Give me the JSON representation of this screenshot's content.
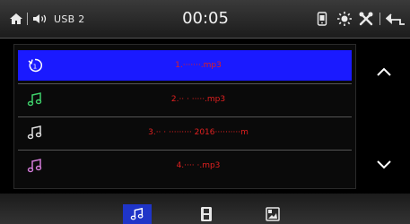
{
  "status_bar": {
    "home_icon": "home-icon",
    "audio_source_icon": "speaker-icon",
    "source_label": "USB 2",
    "clock": "00:05",
    "right_icons": [
      "phone-icon",
      "brightness-icon",
      "tools-icon",
      "back-icon"
    ]
  },
  "track_list": {
    "items": [
      {
        "title": "1.·······.mp3",
        "icon": "repeat-icon",
        "selected": true
      },
      {
        "title": "2.·· · ·····.mp3",
        "icon": "music-note-icon",
        "selected": false
      },
      {
        "title": "3.·· · ········· 2016··········m",
        "icon": "music-note-icon",
        "selected": false
      },
      {
        "title": "4.···· ·.mp3",
        "icon": "music-note-icon",
        "selected": false
      }
    ]
  },
  "scroll": {
    "up_icon": "chevron-up-icon",
    "down_icon": "chevron-down-icon"
  },
  "bottom_tabs": [
    {
      "icon": "music-note-icon",
      "active": true
    },
    {
      "icon": "film-icon",
      "active": false
    },
    {
      "icon": "image-icon",
      "active": false
    }
  ],
  "colors": {
    "selected_row": "#1a1aff",
    "track_text": "#e02020",
    "active_tab": "#1f35c8"
  }
}
